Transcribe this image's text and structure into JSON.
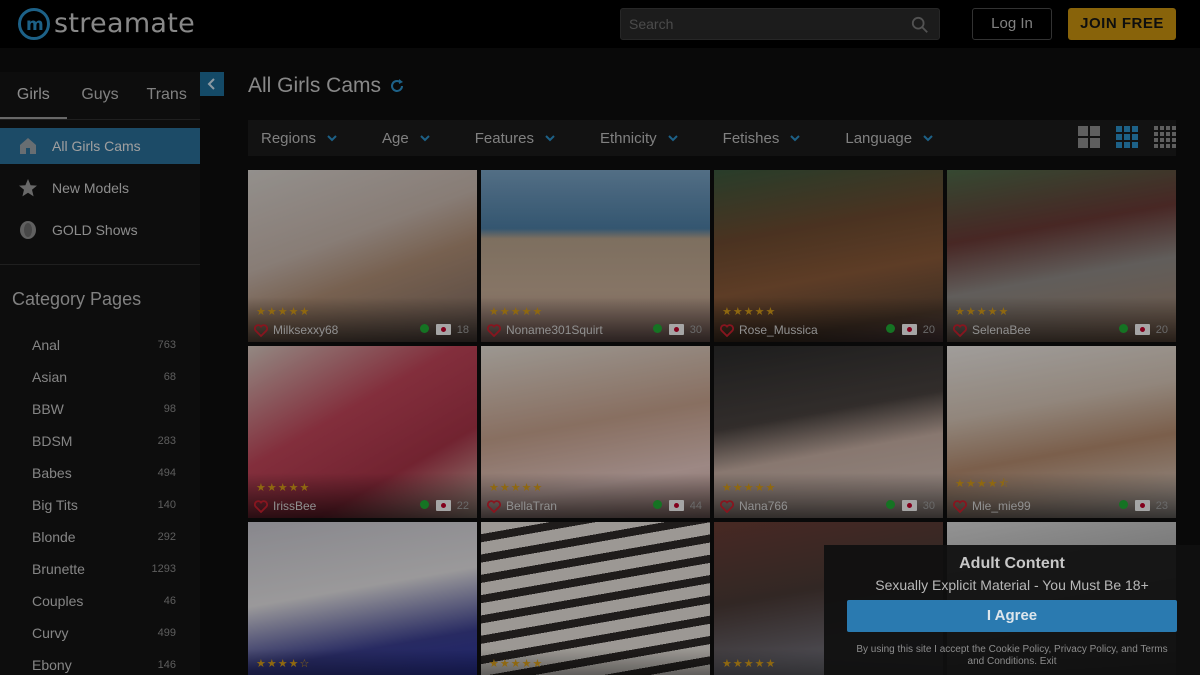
{
  "header": {
    "logo_text": "streamate",
    "search_placeholder": "Search",
    "login_label": "Log In",
    "join_label": "JOIN FREE"
  },
  "sidebar": {
    "tabs": [
      {
        "label": "Girls",
        "active": true
      },
      {
        "label": "Guys",
        "active": false
      },
      {
        "label": "Trans",
        "active": false
      }
    ],
    "nav": [
      {
        "label": "All Girls Cams",
        "icon": "home-icon",
        "active": true
      },
      {
        "label": "New Models",
        "icon": "star-icon",
        "active": false
      },
      {
        "label": "GOLD Shows",
        "icon": "gold-coin-icon",
        "active": false
      }
    ],
    "category_heading": "Category Pages",
    "categories": [
      {
        "label": "Anal",
        "count": "763"
      },
      {
        "label": "Asian",
        "count": "68"
      },
      {
        "label": "BBW",
        "count": "98"
      },
      {
        "label": "BDSM",
        "count": "283"
      },
      {
        "label": "Babes",
        "count": "494"
      },
      {
        "label": "Big Tits",
        "count": "140"
      },
      {
        "label": "Blonde",
        "count": "292"
      },
      {
        "label": "Brunette",
        "count": "1293"
      },
      {
        "label": "Couples",
        "count": "46"
      },
      {
        "label": "Curvy",
        "count": "499"
      },
      {
        "label": "Ebony",
        "count": "146"
      }
    ]
  },
  "main": {
    "title": "All Girls Cams",
    "filters": [
      "Regions",
      "Age",
      "Features",
      "Ethnicity",
      "Fetishes",
      "Language"
    ],
    "view_options": [
      "large-grid-icon",
      "medium-grid-icon",
      "small-grid-icon"
    ],
    "active_view": "medium-grid-icon"
  },
  "models": [
    {
      "name": "Milksexxy68",
      "age": "18",
      "rating": 5,
      "online": true,
      "flag": "japan"
    },
    {
      "name": "Noname301Squirt",
      "age": "30",
      "rating": 5,
      "online": true,
      "flag": "japan"
    },
    {
      "name": "Rose_Mussica",
      "age": "20",
      "rating": 5,
      "online": true,
      "flag": "japan"
    },
    {
      "name": "SelenaBee",
      "age": "20",
      "rating": 5,
      "online": true,
      "flag": "japan"
    },
    {
      "name": "IrissBee",
      "age": "22",
      "rating": 5,
      "online": true,
      "flag": "japan"
    },
    {
      "name": "BellaTran",
      "age": "44",
      "rating": 5,
      "online": true,
      "flag": "japan"
    },
    {
      "name": "Nana766",
      "age": "30",
      "rating": 5,
      "online": true,
      "flag": "japan"
    },
    {
      "name": "Mie_mie99",
      "age": "23",
      "rating": 4.5,
      "online": true,
      "flag": "japan"
    },
    {
      "name": "",
      "age": "",
      "rating": 4,
      "online": false,
      "flag": ""
    },
    {
      "name": "",
      "age": "",
      "rating": 5,
      "online": false,
      "flag": ""
    },
    {
      "name": "",
      "age": "",
      "rating": 5,
      "online": false,
      "flag": ""
    },
    {
      "name": "",
      "age": "",
      "rating": 0,
      "online": false,
      "flag": ""
    }
  ],
  "modal": {
    "title": "Adult Content",
    "subtitle": "Sexually Explicit Material - You Must Be 18+",
    "agree_label": "I Agree",
    "legal_prefix": "By using this site I accept the",
    "cookie_link": "Cookie Policy",
    "comma": ",",
    "privacy_link": "Privacy Policy",
    "and": ", and",
    "terms_link": "Terms and Conditions",
    "dot": ".",
    "exit_link": "Exit"
  },
  "colors": {
    "accent": "#2a6f99",
    "join": "#c9930f",
    "online": "#1faa34",
    "star": "#d39a18",
    "heart": "#c8202e"
  }
}
